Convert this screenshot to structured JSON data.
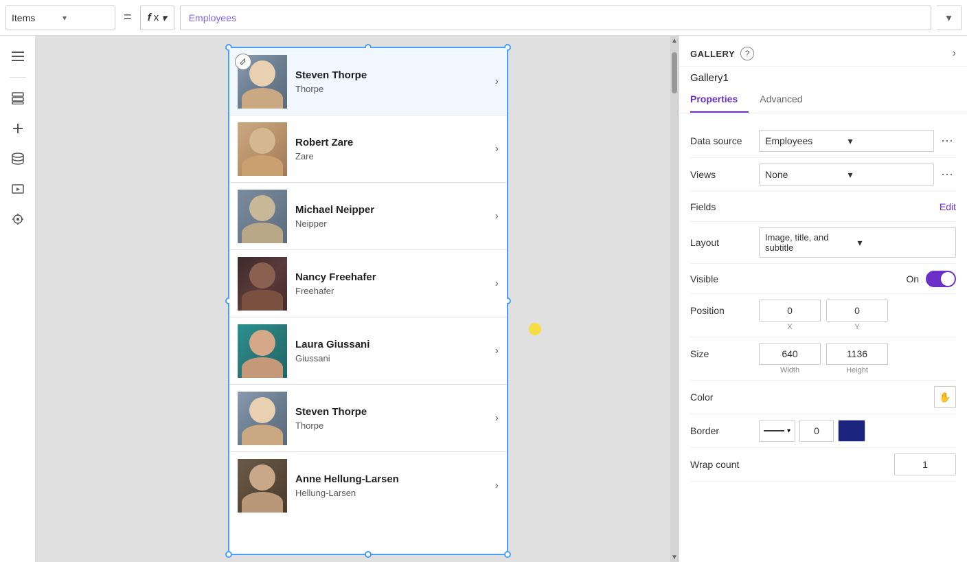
{
  "topbar": {
    "items_label": "Items",
    "equals": "=",
    "fx_label": "fx",
    "formula_value": "Employees",
    "chevron_down": "▾"
  },
  "toolbar": {
    "hamburger": "☰",
    "layers": "⬛",
    "add": "+",
    "database": "⬜",
    "media": "▣",
    "tools": "⚙"
  },
  "gallery": {
    "title": "Gallery1",
    "items": [
      {
        "name": "Steven Thorpe",
        "subtitle": "Thorpe",
        "photo_class": "photo-1",
        "selected": true
      },
      {
        "name": "Robert Zare",
        "subtitle": "Zare",
        "photo_class": "photo-2",
        "selected": false
      },
      {
        "name": "Michael Neipper",
        "subtitle": "Neipper",
        "photo_class": "photo-3",
        "selected": false
      },
      {
        "name": "Nancy Freehafer",
        "subtitle": "Freehafer",
        "photo_class": "photo-4",
        "selected": false
      },
      {
        "name": "Laura Giussani",
        "subtitle": "Giussani",
        "photo_class": "photo-5",
        "selected": false
      },
      {
        "name": "Steven Thorpe",
        "subtitle": "Thorpe",
        "photo_class": "photo-6",
        "selected": false
      },
      {
        "name": "Anne Hellung-Larsen",
        "subtitle": "Hellung-Larsen",
        "photo_class": "photo-7",
        "selected": false
      }
    ]
  },
  "right_panel": {
    "section_label": "GALLERY",
    "help": "?",
    "nav_arrow": "›",
    "gallery_name": "Gallery1",
    "tabs": [
      "Properties",
      "Advanced"
    ],
    "active_tab": "Properties",
    "properties": {
      "data_source_label": "Data source",
      "data_source_value": "Employees",
      "views_label": "Views",
      "views_value": "None",
      "fields_label": "Fields",
      "fields_edit": "Edit",
      "layout_label": "Layout",
      "layout_value": "Image, title, and subtitle",
      "visible_label": "Visible",
      "visible_on": "On",
      "position_label": "Position",
      "pos_x": "0",
      "pos_y": "0",
      "pos_x_label": "X",
      "pos_y_label": "Y",
      "size_label": "Size",
      "size_width": "640",
      "size_height": "1136",
      "size_width_label": "Width",
      "size_height_label": "Height",
      "color_label": "Color",
      "color_icon": "✋",
      "border_label": "Border",
      "border_value": "0",
      "wrap_count_label": "Wrap count",
      "wrap_count_value": "1"
    }
  }
}
